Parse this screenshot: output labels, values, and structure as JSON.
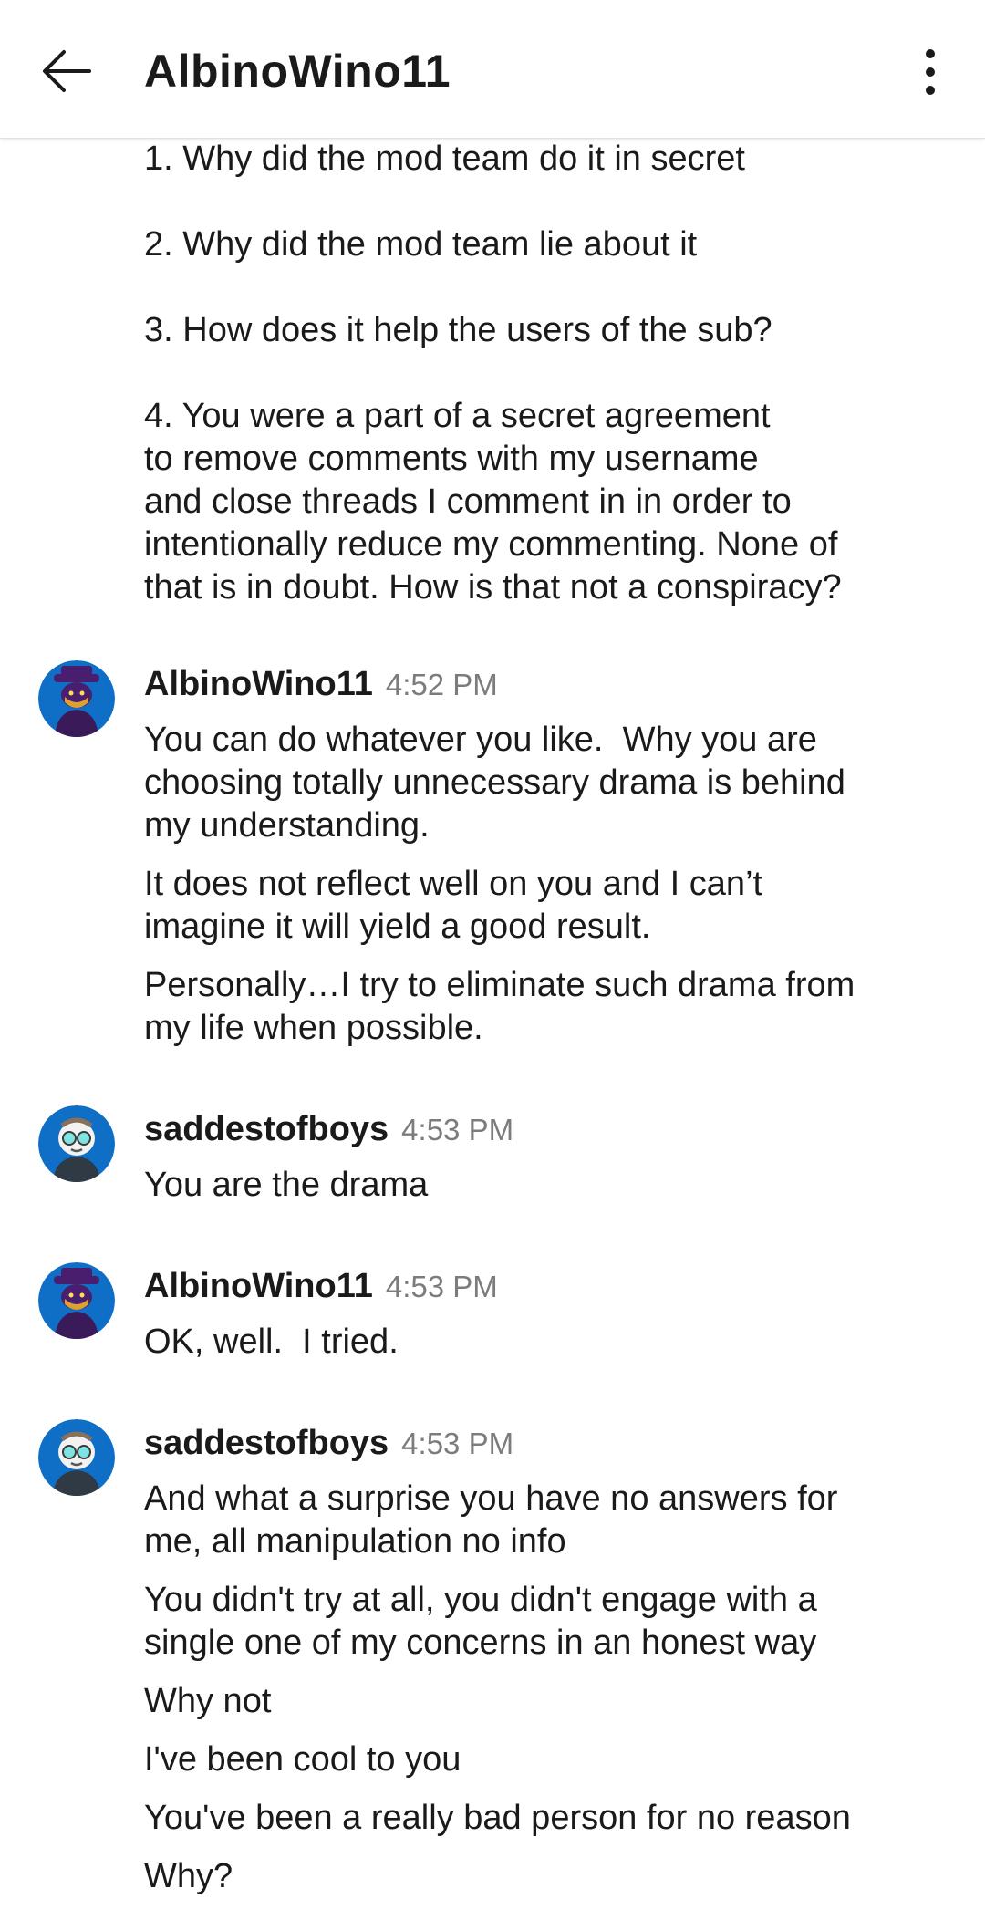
{
  "header": {
    "title": "AlbinoWino11",
    "back_icon": "arrow-left-icon",
    "more_icon": "more-vertical-icon"
  },
  "continued_message": {
    "paragraphs": [
      [
        "1. Why did the mod team do it in secret"
      ],
      [
        "2. Why did the mod team lie about it"
      ],
      [
        "3. How does it help the users of the sub?"
      ],
      [
        "4. You were a part of a secret agreement",
        "to remove comments with my username",
        "and close threads I comment in in order to",
        "intentionally reduce my commenting. None of",
        "that is in doubt. How is that not a conspiracy?"
      ]
    ]
  },
  "messages": [
    {
      "username": "AlbinoWino11",
      "time": "4:52 PM",
      "avatar": "albino-avatar",
      "paragraphs": [
        [
          "You can do whatever you like.  Why you are",
          "choosing totally unnecessary drama is behind",
          "my understanding."
        ],
        [
          "It does not reflect well on you and I can’t",
          "imagine it will yield a good result."
        ],
        [
          "Personally…I try to eliminate such drama from",
          "my life when possible."
        ]
      ]
    },
    {
      "username": "saddestofboys",
      "time": "4:53 PM",
      "avatar": "saddest-avatar",
      "paragraphs": [
        [
          "You are the drama"
        ]
      ]
    },
    {
      "username": "AlbinoWino11",
      "time": "4:53 PM",
      "avatar": "albino-avatar",
      "paragraphs": [
        [
          "OK, well.  I tried."
        ]
      ]
    },
    {
      "username": "saddestofboys",
      "time": "4:53 PM",
      "avatar": "saddest-avatar",
      "paragraphs": [
        [
          "And what a surprise you have no answers for",
          "me, all manipulation no info"
        ],
        [
          "You didn't try at all, you didn't engage with a",
          "single one of my concerns in an honest way"
        ],
        [
          "Why not"
        ],
        [
          "I've been cool to you"
        ],
        [
          "You've been a really bad person for no reason"
        ],
        [
          "Why?"
        ]
      ]
    }
  ],
  "colors": {
    "background": "#ffffff",
    "text": "#1a1a1b",
    "timestamp": "#7c7c7c",
    "avatar_bg": "#0f6fc6"
  }
}
